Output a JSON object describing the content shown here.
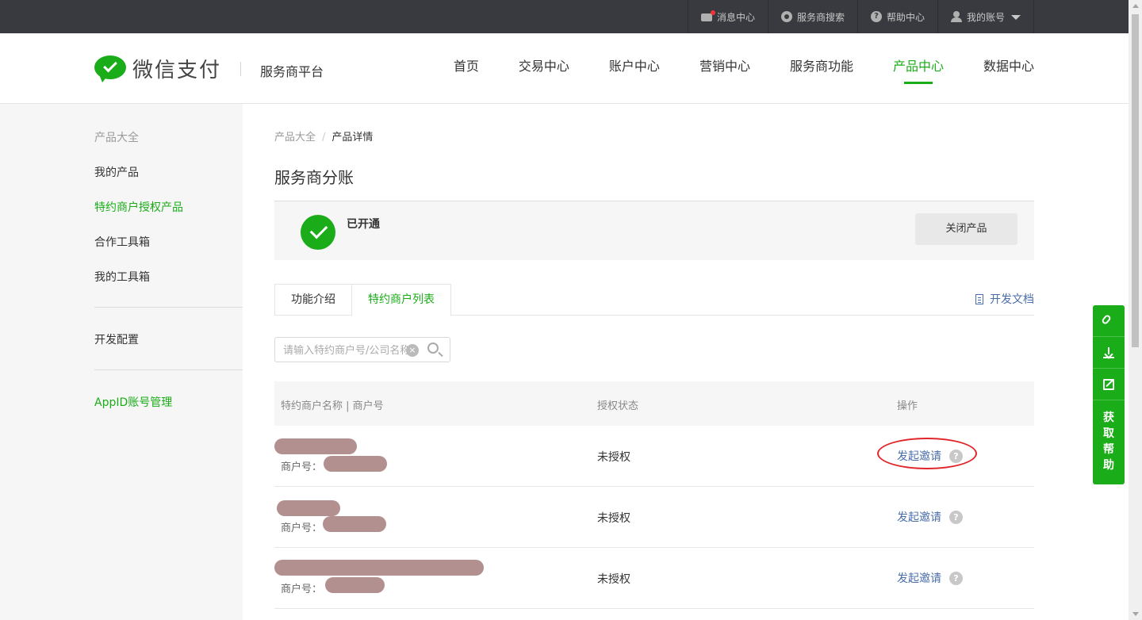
{
  "topbar": {
    "items": [
      {
        "label": "消息中心",
        "icon": "mail-icon"
      },
      {
        "label": "服务商搜索",
        "icon": "search-circle-icon"
      },
      {
        "label": "帮助中心",
        "icon": "help-icon"
      },
      {
        "label": "我的账号",
        "icon": "user-icon"
      }
    ]
  },
  "header": {
    "logo_text": "微信支付",
    "platform": "服务商平台",
    "nav": [
      "首页",
      "交易中心",
      "账户中心",
      "营销中心",
      "服务商功能",
      "产品中心",
      "数据中心"
    ],
    "active_nav": "产品中心"
  },
  "sidebar": {
    "items": [
      "产品大全",
      "我的产品",
      "特约商户授权产品",
      "合作工具箱",
      "我的工具箱",
      "开发配置",
      "AppID账号管理"
    ],
    "active": "特约商户授权产品"
  },
  "breadcrumb": {
    "root": "产品大全",
    "sep": "/",
    "current": "产品详情"
  },
  "page_title": "服务商分账",
  "status": {
    "text": "已开通",
    "close_button": "关闭产品"
  },
  "tabs": [
    "功能介绍",
    "特约商户列表"
  ],
  "active_tab": "特约商户列表",
  "dev_doc": "开发文档",
  "search": {
    "placeholder": "请输入特约商户号/公司名称查询",
    "clear_icon": "×"
  },
  "table": {
    "headers": [
      "特约商户名称 | 商户号",
      "授权状态",
      "操作"
    ],
    "mid_label": "商户号：",
    "rows": [
      {
        "status": "未授权",
        "action": "发起邀请"
      },
      {
        "status": "未授权",
        "action": "发起邀请"
      },
      {
        "status": "未授权",
        "action": "发起邀请"
      }
    ]
  },
  "float_help": {
    "label": "获\n取\n帮\n助",
    "chars": [
      "获",
      "取",
      "帮",
      "助"
    ]
  },
  "colors": {
    "brand": "#1aad19",
    "link": "#4a6ea8",
    "topbar": "#393a3f",
    "annotation": "#e0262a"
  }
}
